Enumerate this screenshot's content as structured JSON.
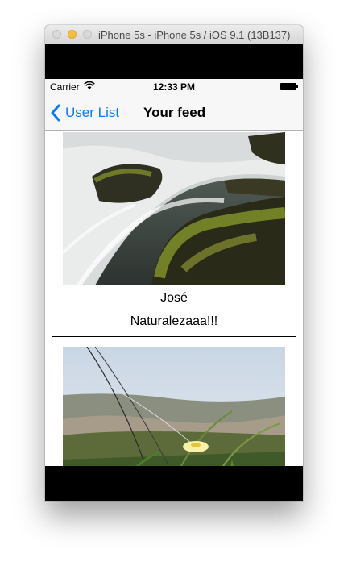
{
  "window": {
    "title": "iPhone 5s - iPhone 5s / iOS 9.1 (13B137)",
    "controls": {
      "close_icon": "close-circle-icon",
      "minimize_icon": "minimize-circle-icon",
      "zoom_icon": "zoom-circle-icon"
    }
  },
  "status_bar": {
    "carrier": "Carrier",
    "time": "12:33 PM",
    "wifi_icon": "wifi-icon",
    "battery_icon": "battery-icon"
  },
  "nav_bar": {
    "back_label": "User List",
    "back_icon": "chevron-left-icon",
    "title": "Your feed",
    "accent_color": "#0a7aff"
  },
  "feed": {
    "posts": [
      {
        "user": "José",
        "caption": "Naturalezaaa!!!",
        "image": "waterfall-rocks-photo"
      },
      {
        "user": "",
        "caption": "",
        "image": "beach-grass-flower-photo"
      }
    ]
  }
}
